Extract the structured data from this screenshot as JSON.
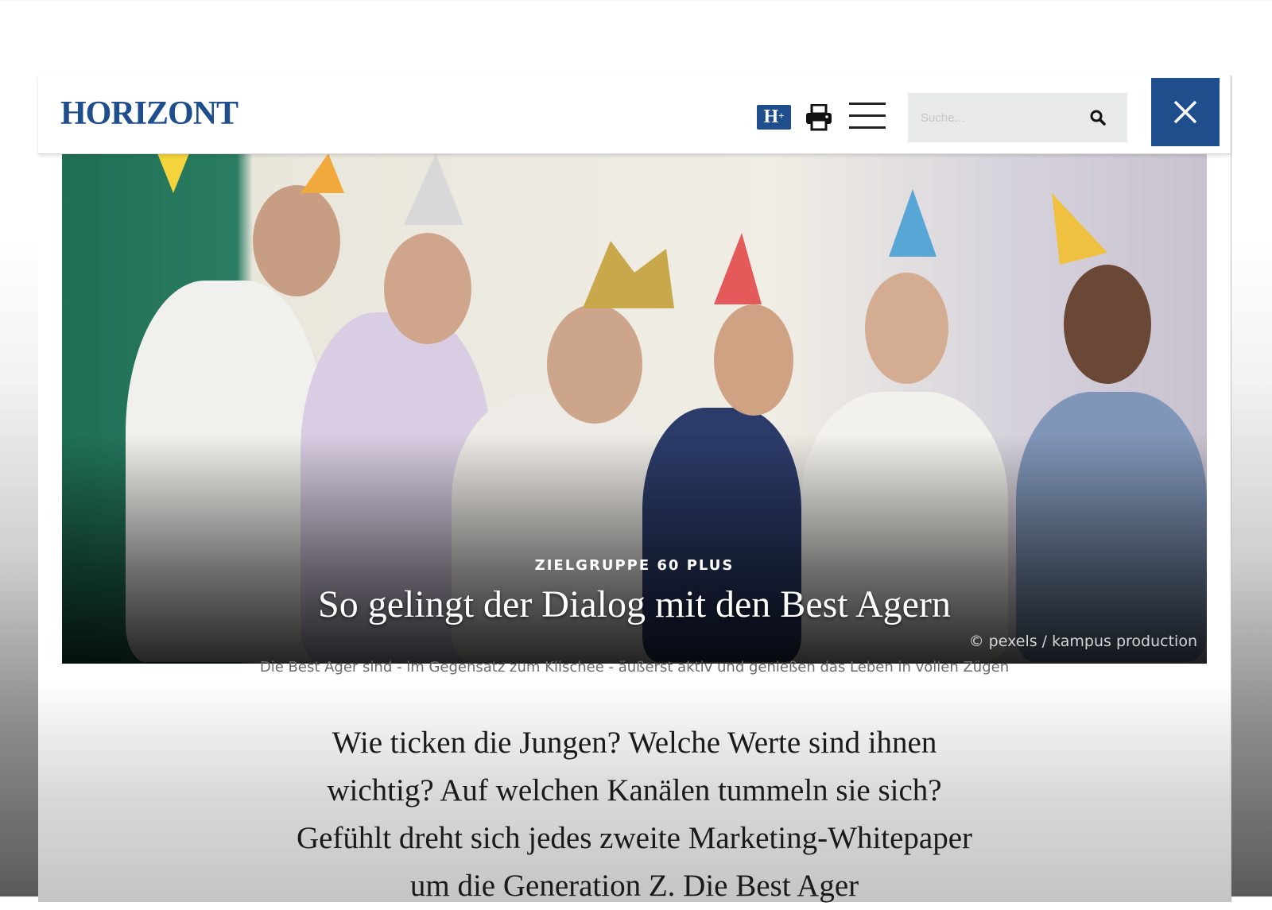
{
  "header": {
    "logo": "HORIZONT",
    "hplus_label": "H",
    "hplus_sup": "+",
    "search_placeholder": "Suche..."
  },
  "hero": {
    "kicker": "ZIELGRUPPE 60 PLUS",
    "headline": "So gelingt der Dialog mit den Best Agern",
    "credit": "© pexels / kampus production"
  },
  "caption": "Die Best Ager sind - im Gegensatz zum Klischee - äußerst aktiv und genießen das Leben in vollen Zügen",
  "intro": "Wie ticken die Jungen? Welche Werte sind ihnen wichtig? Auf welchen Kanälen tummeln sie sich? Gefühlt dreht sich jedes zweite Marketing-Whitepaper um die Generation Z. Die Best Ager",
  "colors": {
    "brand": "#1f4e8c",
    "search_bg": "#e8eaea"
  }
}
